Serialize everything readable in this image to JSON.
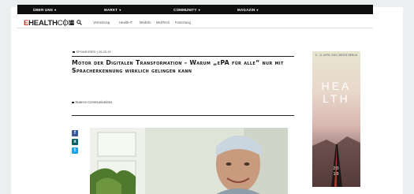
{
  "topnav": {
    "items": [
      {
        "label": "ÜBER UNS",
        "caret": "▾"
      },
      {
        "label": "MARKT",
        "caret": "▾"
      },
      {
        "label": "COMMUNITY",
        "caret": "▾"
      },
      {
        "label": "MAGAZIN",
        "caret": "▾"
      }
    ]
  },
  "brand": {
    "logo_e": "E",
    "logo_health": "HEALTH",
    "logo_com": "COM",
    "user_icon": "user-icon",
    "search_icon": "search-icon",
    "subnav": [
      "Vernetzung",
      "Health-IT",
      "Medizin",
      "MedTech",
      "Forschung"
    ]
  },
  "article": {
    "tag": "SPONSORED | 26.03.19",
    "headline": "Motor der Digitalen Transformation - Warum „ePA für alle“ nur mit Spracherkennung wirklich gelingen kann",
    "author": "Nuance Communications",
    "share": [
      {
        "icon": "facebook-icon",
        "glyph": "f",
        "color": "#3b5998"
      },
      {
        "icon": "xing-icon",
        "glyph": "x",
        "color": "#026466"
      },
      {
        "icon": "twitter-icon",
        "glyph": "t",
        "color": "#1da1f2"
      }
    ]
  },
  "ad": {
    "date": "9. - 11. APRIL 2019 | MESSE BERLIN",
    "title_line1": "HEA",
    "title_line2": "LTH",
    "year_line1": "20",
    "year_line2": "19"
  },
  "colors": {
    "topnav_bg": "#0e0e0e",
    "brand_red": "#c0392b",
    "ad_text": "#ffffff"
  }
}
